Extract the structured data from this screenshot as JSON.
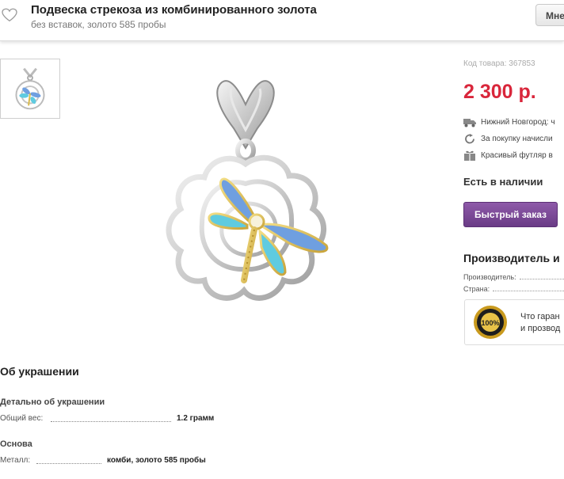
{
  "header": {
    "title": "Подвеска стрекоза из комбинированного золота",
    "subtitle": "без вставок, золото 585 пробы",
    "menu_button_label": "Мне"
  },
  "product": {
    "sku_label": "Код товара: 367853",
    "price": "2 300 р.",
    "delivery": "Нижний Новгород: ч",
    "bonus": "За покупку начисли",
    "gift": "Красивый футляр в",
    "stock": "Есть в наличии",
    "quick_order_label": "Быстрый заказ"
  },
  "manufacturer": {
    "title": "Производитель и",
    "maker_label": "Производитель:",
    "country_label": "Страна:",
    "guarantee_line1": "Что гаран",
    "guarantee_line2": "и прозвод",
    "seal_text": "100%"
  },
  "details": {
    "about_title": "Об украшении",
    "section1_title": "Детально об украшении",
    "weight_label": "Общий вес:",
    "weight_value": "1.2 грамм",
    "section2_title": "Основа",
    "metal_label": "Металл:",
    "metal_value": "комби, золото 585 пробы"
  },
  "colors": {
    "price": "#d9263b",
    "quick_order": "#7b4a98",
    "gold": "#d8b94a",
    "enamel_blue": "#6f9fe0",
    "enamel_turquoise": "#5fcbe0"
  }
}
